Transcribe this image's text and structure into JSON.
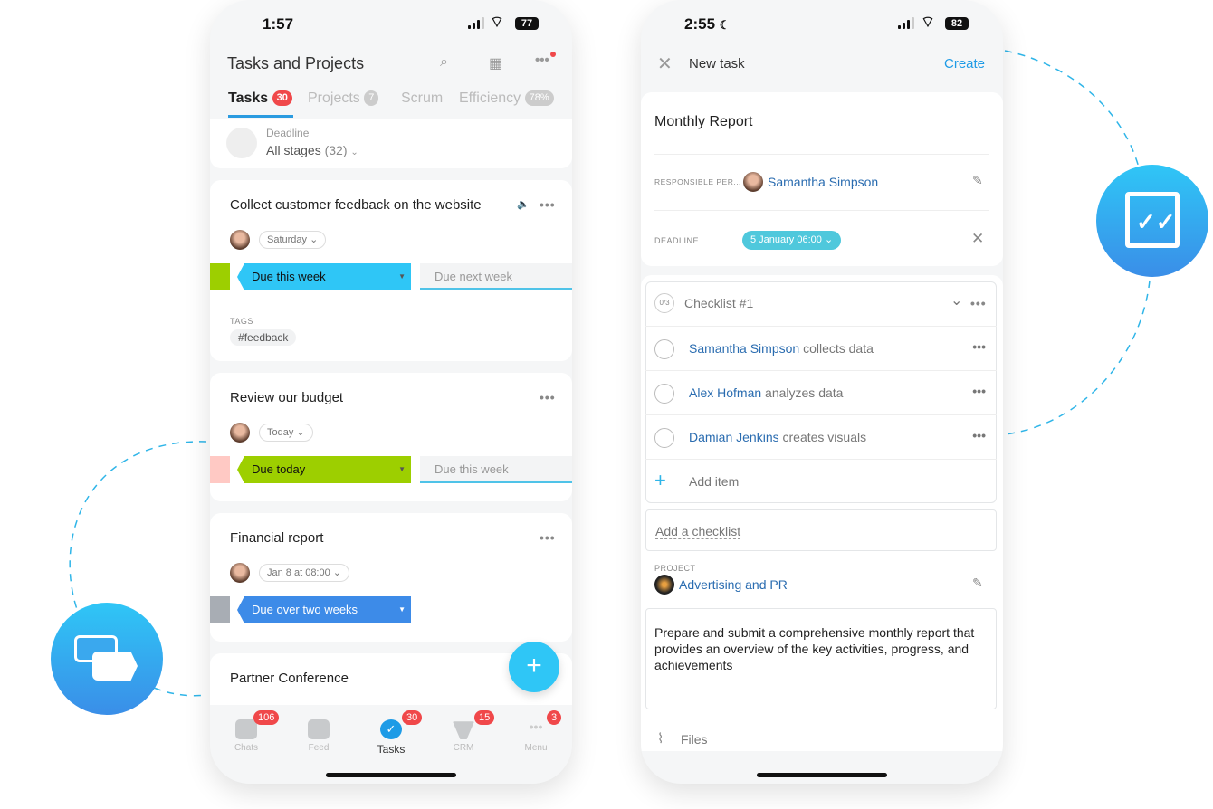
{
  "left_phone": {
    "status": {
      "time": "1:57",
      "battery": "77"
    },
    "header": {
      "title": "Tasks and Projects"
    },
    "tabs": [
      {
        "label": "Tasks",
        "badge": "30"
      },
      {
        "label": "Projects",
        "badge": "7"
      },
      {
        "label": "Scrum"
      },
      {
        "label": "Efficiency",
        "badge": "78%"
      }
    ],
    "filter": {
      "label": "Deadline",
      "value": "All stages",
      "count": "(32)"
    },
    "tasks": [
      {
        "title": "Collect customer feedback on the website",
        "date": "Saturday",
        "stage": "Due this week",
        "stage_color": "#2fc6f6",
        "prev_color": "#9dcf00",
        "next": "Due next week",
        "tags_label": "TAGS",
        "tag": "feedback"
      },
      {
        "title": "Review our budget",
        "date": "Today",
        "stage": "Due today",
        "stage_color": "#9dcf00",
        "prev_color": "#ffc9c4",
        "next": "Due this week"
      },
      {
        "title": "Financial report",
        "date": "Jan 8 at 08:00",
        "stage": "Due over two weeks",
        "stage_color": "#3d8be8",
        "prev_color": "#a8adb4"
      },
      {
        "title": "Partner Conference"
      }
    ],
    "bottom_nav": [
      {
        "label": "Chats",
        "badge": "106"
      },
      {
        "label": "Feed"
      },
      {
        "label": "Tasks",
        "badge": "30"
      },
      {
        "label": "CRM",
        "badge": "15"
      },
      {
        "label": "Menu",
        "badge": "3"
      }
    ]
  },
  "right_phone": {
    "status": {
      "time": "2:55",
      "battery": "82"
    },
    "header": {
      "title": "New task",
      "create": "Create"
    },
    "task_title": "Monthly Report",
    "responsible": {
      "label": "RESPONSIBLE PER...",
      "name": "Samantha Simpson"
    },
    "deadline": {
      "label": "DEADLINE",
      "value": "5 January 06:00"
    },
    "checklist": {
      "progress": "0/3",
      "title": "Checklist #1",
      "items": [
        {
          "person": "Samantha Simpson",
          "text": " collects data"
        },
        {
          "person": "Alex Hofman",
          "text": " analyzes data"
        },
        {
          "person": "Damian Jenkins",
          "text": " creates visuals"
        }
      ],
      "add_item": "Add item"
    },
    "add_checklist": "Add a checklist",
    "project": {
      "label": "PROJECT",
      "name": "Advertising and PR"
    },
    "description": "Prepare and submit a comprehensive monthly report that provides an overview of the key activities, progress, and achievements",
    "files": "Files"
  },
  "colors": {
    "accent": "#2fc6f6",
    "link": "#2a6cb0",
    "badge": "#f0484a"
  }
}
